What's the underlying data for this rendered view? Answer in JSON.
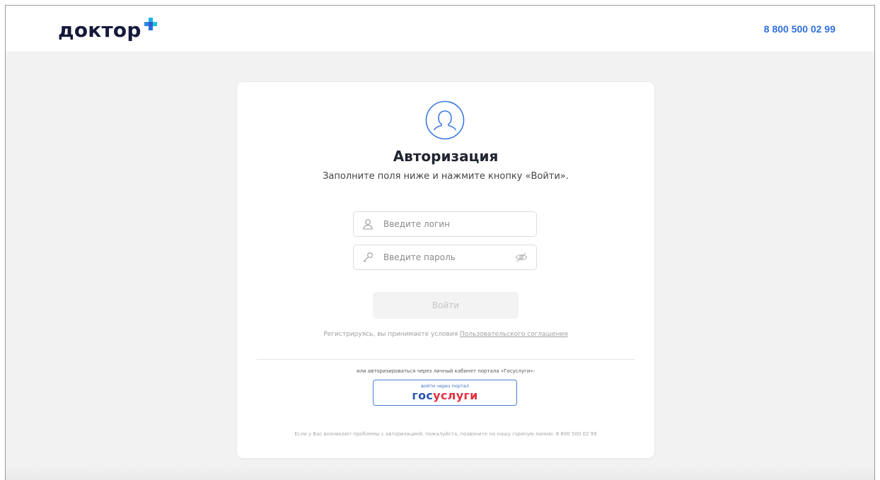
{
  "header": {
    "logo_text": "доктор",
    "phone": "8 800 500 02 99"
  },
  "auth": {
    "title": "Авторизация",
    "subtitle": "Заполните поля ниже и нажмите кнопку «Войти».",
    "login_placeholder": "Введите логин",
    "password_placeholder": "Введите пароль",
    "submit_label": "Войти",
    "terms_prefix": "Регистрируясь, вы принимаете условия ",
    "terms_link": "Пользовательского соглашения",
    "gosuslugi_hint": "или авторизироваться через личный кабинет портала «Госуслуги»:",
    "gosuslugi_small": "войти через портал",
    "gosuslugi_brand_part1": "гос",
    "gosuslugi_brand_part2": "услуги",
    "help_note": "Если у Вас возникают проблемы с авторизацией, пожалуйста, позвоните на нашу горячую линию: 8 800 500 02 99"
  },
  "colors": {
    "brand_blue": "#2f6fdd",
    "logo_dark": "#15193a",
    "gos_blue": "#2a54b0",
    "gos_red": "#e0303f"
  },
  "icons": {
    "avatar": "user-circle-icon",
    "login": "user-icon",
    "password": "key-icon",
    "visibility": "eye-off-icon"
  }
}
